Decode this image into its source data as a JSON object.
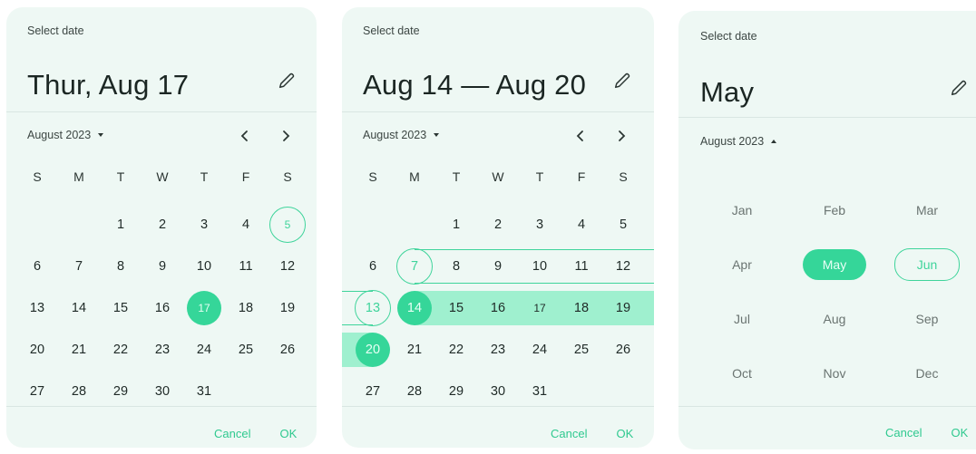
{
  "colors": {
    "accent": "#35d699",
    "range": "#9ff0cf",
    "panel": "#eef8f4"
  },
  "weekdays": [
    "S",
    "M",
    "T",
    "W",
    "T",
    "F",
    "S"
  ],
  "single": {
    "label": "Select date",
    "headline": "Thur, Aug 17",
    "month": "August 2023",
    "cancel": "Cancel",
    "ok": "OK",
    "weeks": [
      [
        "",
        "",
        "1",
        "2",
        "3",
        "4",
        "5"
      ],
      [
        "6",
        "7",
        "8",
        "9",
        "10",
        "11",
        "12"
      ],
      [
        "13",
        "14",
        "15",
        "16",
        "17",
        "18",
        "19"
      ],
      [
        "20",
        "21",
        "22",
        "23",
        "24",
        "25",
        "26"
      ],
      [
        "27",
        "28",
        "29",
        "30",
        "31",
        "",
        ""
      ]
    ],
    "today": "5",
    "selected": "17"
  },
  "range": {
    "label": "Select date",
    "headline": "Aug 14 — Aug 20",
    "month": "August 2023",
    "cancel": "Cancel",
    "ok": "OK",
    "weeks": [
      [
        "",
        "",
        "1",
        "2",
        "3",
        "4",
        "5"
      ],
      [
        "6",
        "7",
        "8",
        "9",
        "10",
        "11",
        "12"
      ],
      [
        "13",
        "14",
        "15",
        "16",
        "17",
        "18",
        "19"
      ],
      [
        "20",
        "21",
        "22",
        "23",
        "24",
        "25",
        "26"
      ],
      [
        "27",
        "28",
        "29",
        "30",
        "31",
        "",
        ""
      ]
    ],
    "start": "14",
    "end": "20"
  },
  "month_picker": {
    "label": "Select date",
    "headline": "May",
    "month": "August 2023",
    "cancel": "Cancel",
    "ok": "OK",
    "months": [
      [
        "Jan",
        "Feb",
        "Mar"
      ],
      [
        "Apr",
        "May",
        "Jun"
      ],
      [
        "Jul",
        "Aug",
        "Sep"
      ],
      [
        "Oct",
        "Nov",
        "Dec"
      ]
    ],
    "selected": "May",
    "current": "Jun"
  }
}
